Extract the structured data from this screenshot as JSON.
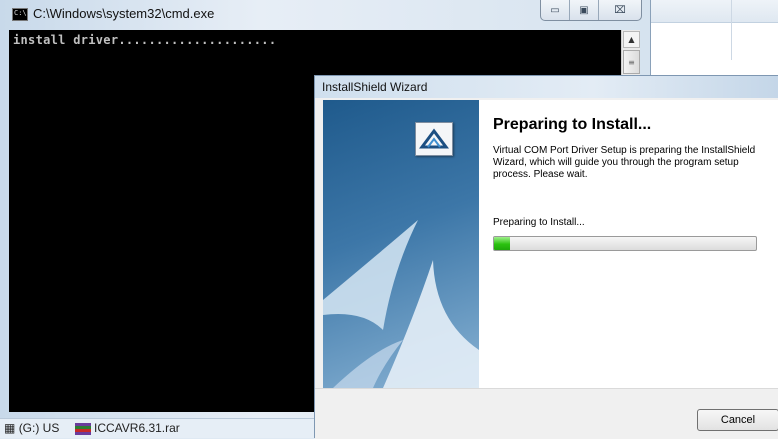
{
  "cmd_window": {
    "title": "C:\\Windows\\system32\\cmd.exe",
    "icon": "console-icon",
    "icon_label": "C:\\",
    "console_text": "install driver.....................",
    "controls": {
      "minimize": "▭",
      "maximize": "▣",
      "close": "⌧"
    },
    "scroll_up_glyph": "▲",
    "scroll_thumb_glyph": "≡"
  },
  "taskbar": {
    "drive_label": "(G:) US",
    "drive_icon": "drive-icon",
    "file_label": "ICCAVR6.31.rar",
    "file_icon": "winrar-archive-icon"
  },
  "wizard": {
    "title": "InstallShield Wizard",
    "heading": "Preparing to Install...",
    "description": "Virtual COM Port Driver Setup is preparing the InstallShield Wizard, which will guide you through the program setup process.  Please wait.",
    "status_text": "Preparing to Install...",
    "progress_fraction": 0.06,
    "progress_color": "#2bc20f",
    "cancel_label": "Cancel",
    "logo_icon": "installshield-logo-icon"
  }
}
